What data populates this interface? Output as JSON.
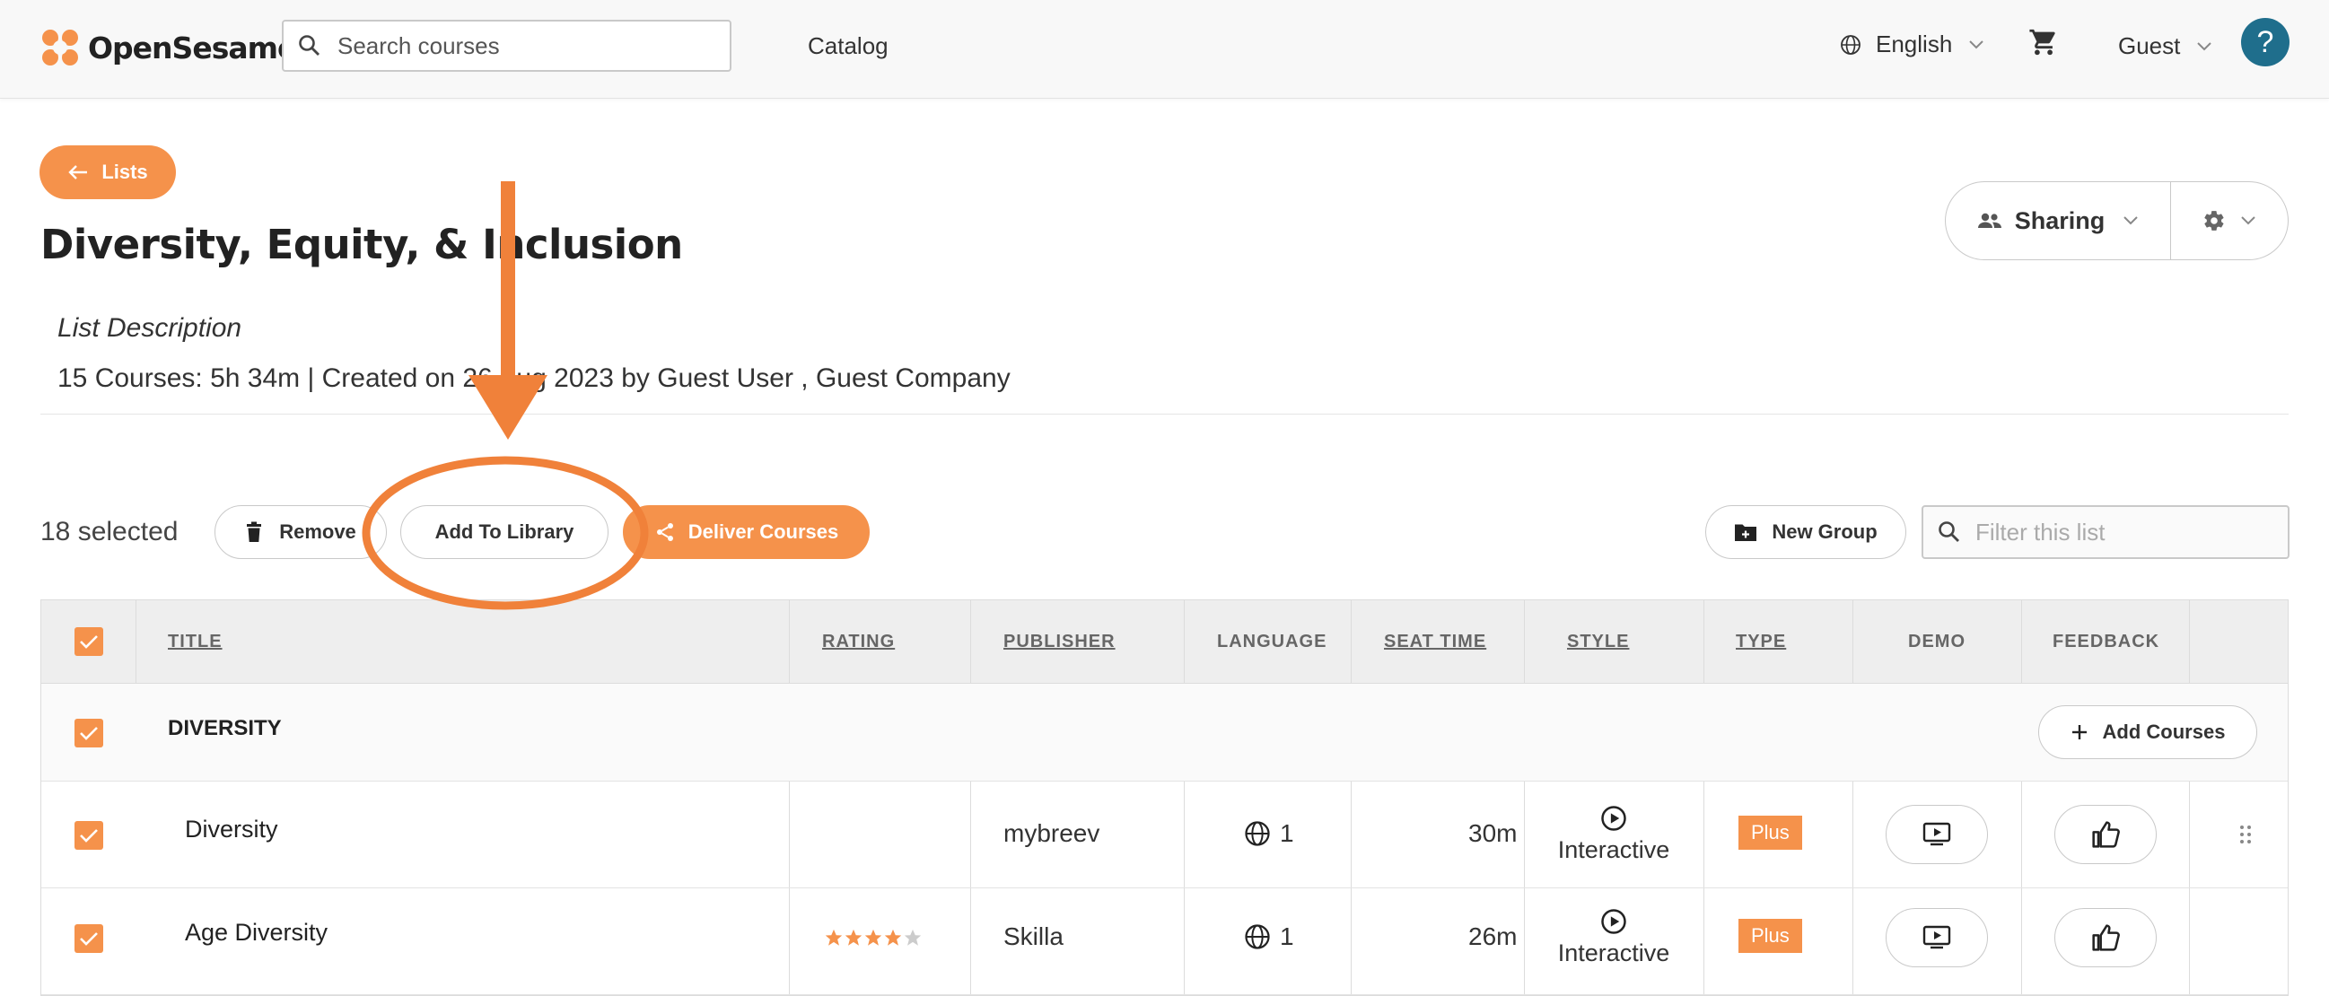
{
  "header": {
    "brand": "OpenSesame",
    "search_placeholder": "Search courses",
    "nav_catalog": "Catalog",
    "language": "English",
    "user": "Guest",
    "help": "?"
  },
  "page": {
    "back_label": "Lists",
    "title": "Diversity, Equity, & Inclusion",
    "sharing_label": "Sharing",
    "description_label": "List Description",
    "meta": "15 Courses: 5h 34m | Created on 26 Aug 2023 by Guest User , Guest Company"
  },
  "toolbar": {
    "selected": "18 selected",
    "remove": "Remove",
    "add_to_library": "Add To Library",
    "deliver": "Deliver Courses",
    "new_group": "New Group",
    "filter_placeholder": "Filter this list"
  },
  "table": {
    "headers": {
      "title": "TITLE",
      "rating": "RATING",
      "publisher": "PUBLISHER",
      "language": "LANGUAGE",
      "seat_time": "SEAT TIME",
      "style": "STYLE",
      "type": "TYPE",
      "demo": "DEMO",
      "feedback": "FEEDBACK"
    },
    "group": {
      "name": "DIVERSITY",
      "add_courses": "Add Courses"
    },
    "rows": [
      {
        "title": "Diversity",
        "rating": null,
        "publisher": "mybreev",
        "languages": "1",
        "seat_time": "30m",
        "style": "Interactive",
        "type": "Plus"
      },
      {
        "title": "Age Diversity",
        "rating": 4,
        "publisher": "Skilla",
        "languages": "1",
        "seat_time": "26m",
        "style": "Interactive",
        "type": "Plus"
      }
    ]
  },
  "colors": {
    "accent": "#f5924b",
    "help_button": "#1f6e8c",
    "annotation": "#f0813a"
  }
}
